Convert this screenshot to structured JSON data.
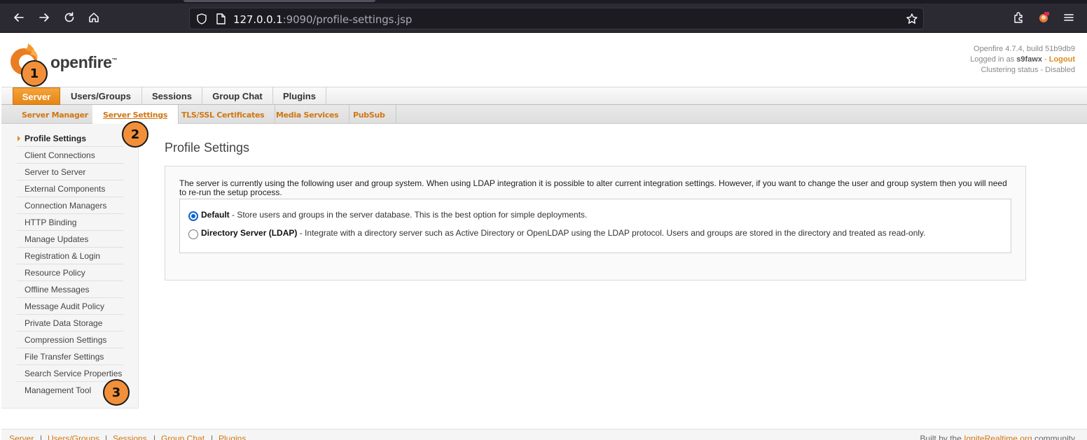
{
  "browser": {
    "url_host": "127.0.0.1",
    "url_rest": ":9090/profile-settings.jsp"
  },
  "header": {
    "logo_text": "openfire",
    "version": "Openfire 4.7.4, build 51b9db9",
    "logged_in_prefix": "Logged in as",
    "username": "s9fawx",
    "logout_label": "Logout",
    "clustering": "Clustering status - Disabled"
  },
  "main_tabs": [
    "Server",
    "Users/Groups",
    "Sessions",
    "Group Chat",
    "Plugins"
  ],
  "sub_tabs": [
    "Server Manager",
    "Server Settings",
    "TLS/SSL Certificates",
    "Media Services",
    "PubSub"
  ],
  "sidebar": {
    "items": [
      "Profile Settings",
      "Client Connections",
      "Server to Server",
      "External Components",
      "Connection Managers",
      "HTTP Binding",
      "Manage Updates",
      "Registration & Login",
      "Resource Policy",
      "Offline Messages",
      "Message Audit Policy",
      "Private Data Storage",
      "Compression Settings",
      "File Transfer Settings",
      "Search Service Properties",
      "Management Tool"
    ]
  },
  "main": {
    "title": "Profile Settings",
    "description": "The server is currently using the following user and group system. When using LDAP integration it is possible to alter current integration settings. However, if you want to change the user and group system then you will need to re-run the setup process.",
    "options": [
      {
        "label": "Default",
        "text": " - Store users and groups in the server database. This is the best option for simple deployments.",
        "selected": true
      },
      {
        "label": "Directory Server (LDAP)",
        "text": " - Integrate with a directory server such as Active Directory or OpenLDAP using the LDAP protocol. Users and groups are stored in the directory and treated as read-only.",
        "selected": false
      }
    ]
  },
  "footer": {
    "links": [
      "Server",
      "Users/Groups",
      "Sessions",
      "Group Chat",
      "Plugins"
    ],
    "separator": "|",
    "credit_prefix": "Built by the",
    "credit_link": "IgniteRealtime.org",
    "credit_suffix": "community"
  },
  "markers": [
    "1",
    "2",
    "3"
  ],
  "colors": {
    "accent": "#e58615",
    "link": "#d07714",
    "browser_bg": "#2b2a33"
  }
}
